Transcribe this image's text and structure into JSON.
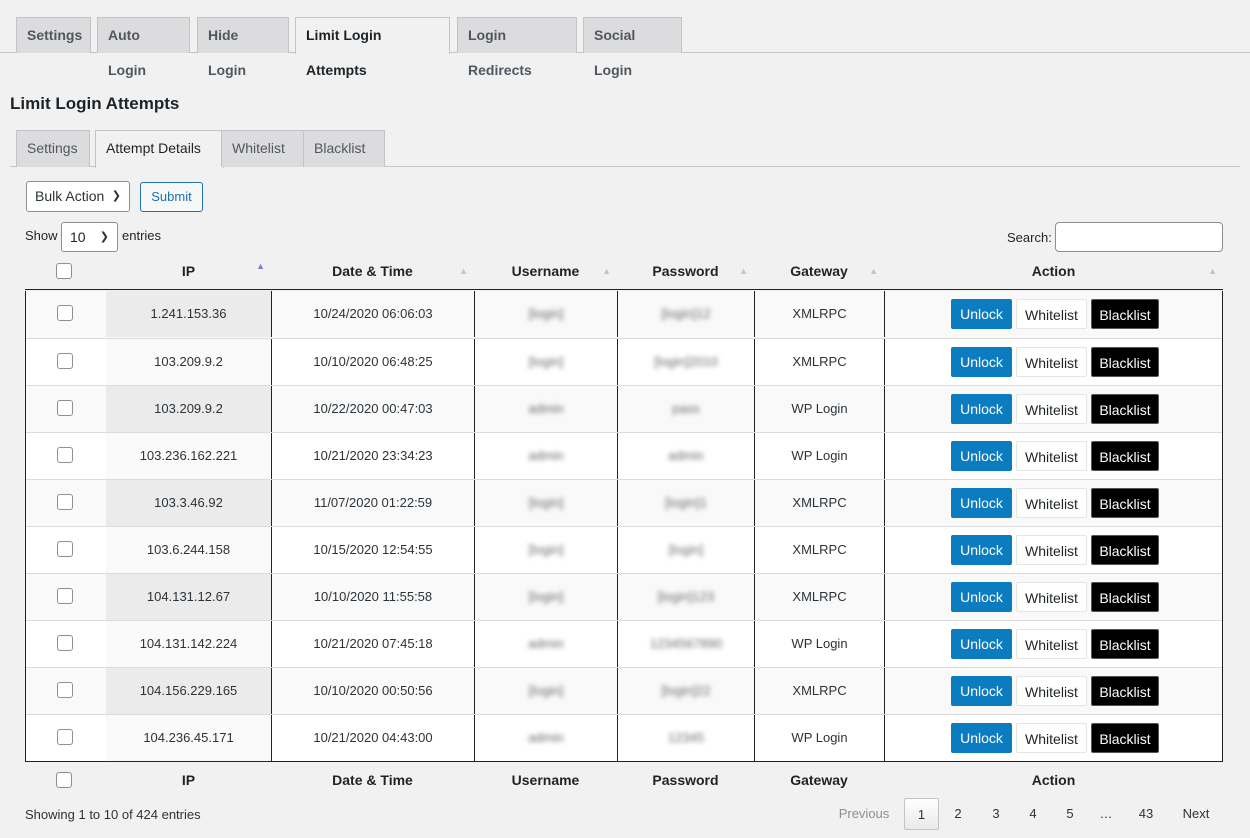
{
  "top_tabs": [
    {
      "label": "Settings",
      "active": false
    },
    {
      "label": "Auto Login",
      "active": false
    },
    {
      "label": "Hide Login",
      "active": false
    },
    {
      "label": "Limit Login Attempts",
      "active": true
    },
    {
      "label": "Login Redirects",
      "active": false
    },
    {
      "label": "Social Login",
      "active": false
    }
  ],
  "page_title": "Limit Login Attempts",
  "sub_tabs": [
    {
      "label": "Settings",
      "active": false
    },
    {
      "label": "Attempt Details",
      "active": true
    },
    {
      "label": "Whitelist",
      "active": false
    },
    {
      "label": "Blacklist",
      "active": false
    }
  ],
  "bulk": {
    "select_value": "Bulk Action",
    "submit_label": "Submit"
  },
  "length": {
    "show_label": "Show",
    "value": "10",
    "entries_label": "entries"
  },
  "search": {
    "label": "Search:",
    "value": ""
  },
  "columns": [
    "IP",
    "Date & Time",
    "Username",
    "Password",
    "Gateway",
    "Action"
  ],
  "actions": {
    "unlock": "Unlock",
    "whitelist": "Whitelist",
    "blacklist": "Blacklist"
  },
  "rows": [
    {
      "ip": "1.241.153.36",
      "datetime": "10/24/2020 06:06:03",
      "username": "[login]",
      "password": "[login]12",
      "gateway": "XMLRPC"
    },
    {
      "ip": "103.209.9.2",
      "datetime": "10/10/2020 06:48:25",
      "username": "[login]",
      "password": "[login]2010",
      "gateway": "XMLRPC"
    },
    {
      "ip": "103.209.9.2",
      "datetime": "10/22/2020 00:47:03",
      "username": "admin",
      "password": "pass",
      "gateway": "WP Login"
    },
    {
      "ip": "103.236.162.221",
      "datetime": "10/21/2020 23:34:23",
      "username": "admin",
      "password": "admin",
      "gateway": "WP Login"
    },
    {
      "ip": "103.3.46.92",
      "datetime": "11/07/2020 01:22:59",
      "username": "[login]",
      "password": "[login]1",
      "gateway": "XMLRPC"
    },
    {
      "ip": "103.6.244.158",
      "datetime": "10/15/2020 12:54:55",
      "username": "[login]",
      "password": "[login]",
      "gateway": "XMLRPC"
    },
    {
      "ip": "104.131.12.67",
      "datetime": "10/10/2020 11:55:58",
      "username": "[login]",
      "password": "[login]123",
      "gateway": "XMLRPC"
    },
    {
      "ip": "104.131.142.224",
      "datetime": "10/21/2020 07:45:18",
      "username": "admin",
      "password": "1234567890",
      "gateway": "WP Login"
    },
    {
      "ip": "104.156.229.165",
      "datetime": "10/10/2020 00:50:56",
      "username": "[login]",
      "password": "[login]22",
      "gateway": "XMLRPC"
    },
    {
      "ip": "104.236.45.171",
      "datetime": "10/21/2020 04:43:00",
      "username": "admin",
      "password": "12345",
      "gateway": "WP Login"
    }
  ],
  "info": "Showing 1 to 10 of 424 entries",
  "pagination": {
    "previous": "Previous",
    "pages": [
      "1",
      "2",
      "3",
      "4",
      "5",
      "…",
      "43"
    ],
    "current": "1",
    "next": "Next"
  },
  "colors": {
    "unlock_bg": "#0c7cc1",
    "blacklist_bg": "#000000",
    "sort_active": "#7a7fd6"
  }
}
